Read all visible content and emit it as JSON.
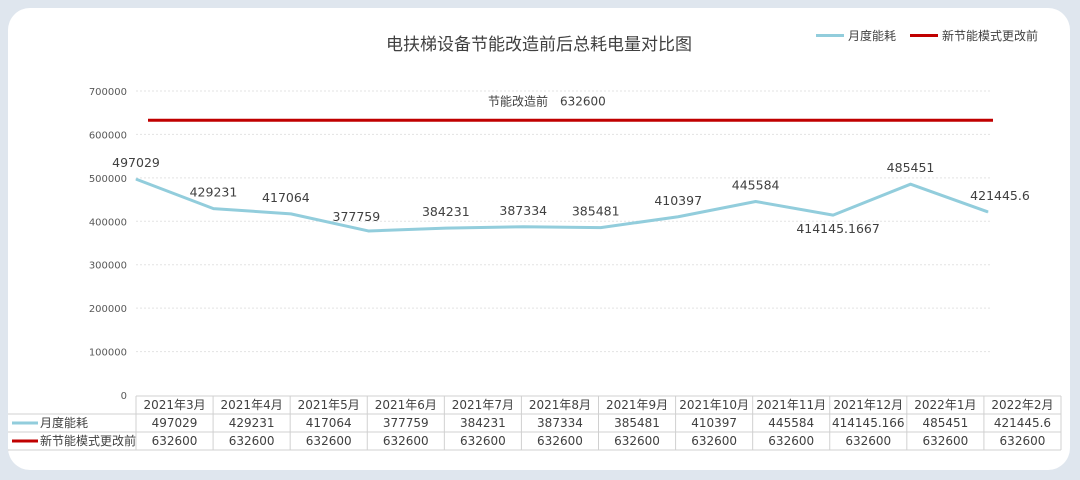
{
  "chart_data": {
    "type": "line",
    "title": "电扶梯设备节能改造前后总耗电量对比图",
    "categories": [
      "2021年3月",
      "2021年4月",
      "2021年5月",
      "2021年6月",
      "2021年7月",
      "2021年8月",
      "2021年9月",
      "2021年10月",
      "2021年11月",
      "2021年12月",
      "2022年1月",
      "2022年2月"
    ],
    "series": [
      {
        "name": "月度能耗",
        "color": "#92cddc",
        "values": [
          497029,
          429231,
          417064,
          377759,
          384231,
          387334,
          385481,
          410397,
          445584,
          414145.1667,
          485451,
          421445.6
        ],
        "point_labels": [
          "497029",
          "429231",
          "417064",
          "377759",
          "384231",
          "387334",
          "385481",
          "410397",
          "445584",
          "414145.1667",
          "485451",
          "421445.6"
        ],
        "table_values": [
          "497029",
          "429231",
          "417064",
          "377759",
          "384231",
          "387334",
          "385481",
          "410397",
          "445584",
          "414145.166",
          "485451",
          "421445.6"
        ]
      },
      {
        "name": "新节能模式更改前",
        "color": "#c00000",
        "values": [
          632600,
          632600,
          632600,
          632600,
          632600,
          632600,
          632600,
          632600,
          632600,
          632600,
          632600,
          632600
        ],
        "table_values": [
          "632600",
          "632600",
          "632600",
          "632600",
          "632600",
          "632600",
          "632600",
          "632600",
          "632600",
          "632600",
          "632600",
          "632600"
        ]
      }
    ],
    "reference_label": "节能改造前",
    "reference_value": "632600",
    "ylim": [
      0,
      700000
    ],
    "yticks": [
      "0",
      "100000",
      "200000",
      "300000",
      "400000",
      "500000",
      "600000",
      "700000"
    ],
    "grid": true,
    "legend_position": "top-right",
    "data_table": true
  }
}
